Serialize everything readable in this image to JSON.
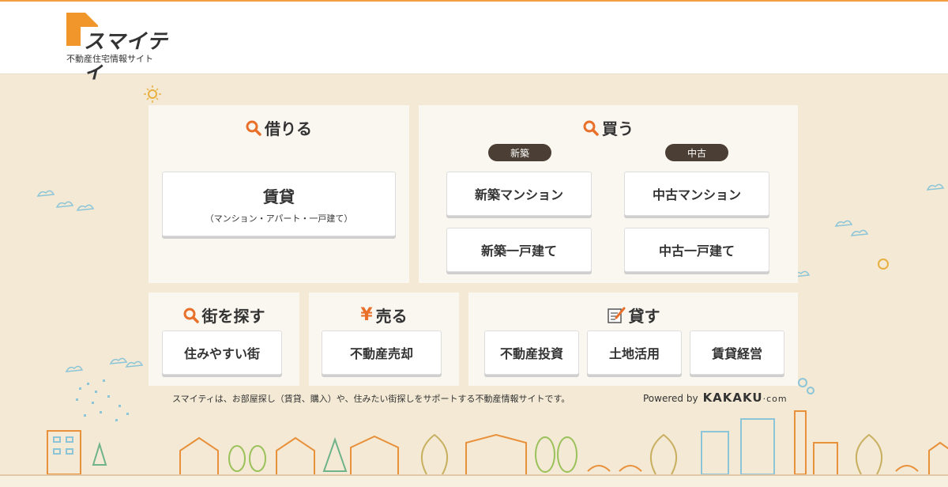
{
  "header": {
    "logo_text": "スマイティ",
    "logo_sub": "不動産住宅情報サイト"
  },
  "rent": {
    "title": "借りる",
    "button_main": "賃貸",
    "button_sub": "（マンション・アパート・一戸建て）"
  },
  "buy": {
    "title": "買う",
    "tag_new": "新築",
    "tag_used": "中古",
    "new_mansion": "新築マンション",
    "used_mansion": "中古マンション",
    "new_house": "新築一戸建て",
    "used_house": "中古一戸建て"
  },
  "town": {
    "title": "街を探す",
    "button": "住みやすい街"
  },
  "sell": {
    "title": "売る",
    "icon": "yen-icon",
    "button": "不動産売却"
  },
  "lend": {
    "title": "貸す",
    "icon": "memo-pen-icon",
    "investment": "不動産投資",
    "land": "土地活用",
    "management": "賃貸経営"
  },
  "footer": {
    "description": "スマイティは、お部屋探し（賃貸、購入）や、住みたい街探しをサポートする不動産情報サイトです。",
    "powered_by": "Powered by",
    "brand": "KAKAKU",
    "brand_suffix": "·com"
  },
  "colors": {
    "accent": "#e8702a",
    "background": "#f3e9d4",
    "panel": "#faf7f0",
    "tag": "#4b3f35"
  }
}
